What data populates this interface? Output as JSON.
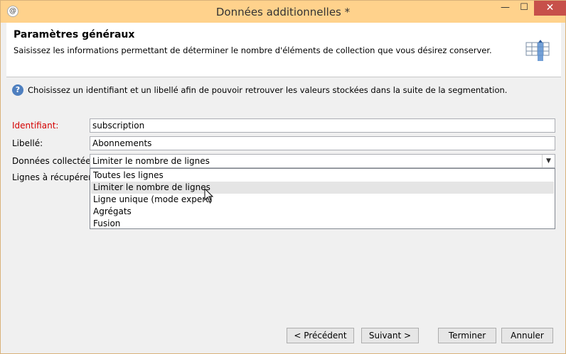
{
  "window": {
    "title": "Données additionnelles *",
    "min_label": "—",
    "max_label": "☐",
    "close_label": "✕"
  },
  "header": {
    "title": "Paramètres généraux",
    "subtitle": "Saisissez les informations permettant de déterminer le nombre d'éléments de collection que vous désirez conserver."
  },
  "info": {
    "icon_glyph": "?",
    "text": "Choisissez un identifiant et un libellé afin de pouvoir retrouver les valeurs stockées dans la suite de la segmentation."
  },
  "form": {
    "identifiant_label": "Identifiant:",
    "identifiant_value": "subscription",
    "libelle_label": "Libellé:",
    "libelle_value": "Abonnements",
    "donnees_label": "Données collectées:",
    "donnees_value": "Limiter le nombre de lignes",
    "lignes_label": "Lignes à récupérer:"
  },
  "dropdown": {
    "options": [
      "Toutes les lignes",
      "Limiter le nombre de lignes",
      "Ligne unique (mode expert)",
      "Agrégats",
      "Fusion"
    ],
    "highlighted": "Limiter le nombre de lignes"
  },
  "buttons": {
    "prev": "< Précédent",
    "next": "Suivant >",
    "finish": "Terminer",
    "cancel": "Annuler"
  },
  "colors": {
    "titlebar": "#ffd28c",
    "close": "#c7504a",
    "required_label": "#d40000"
  },
  "icons": {
    "app": "app-logo-icon",
    "header": "table-columns-icon",
    "info": "help-icon",
    "dropdown": "chevron-down-icon"
  }
}
